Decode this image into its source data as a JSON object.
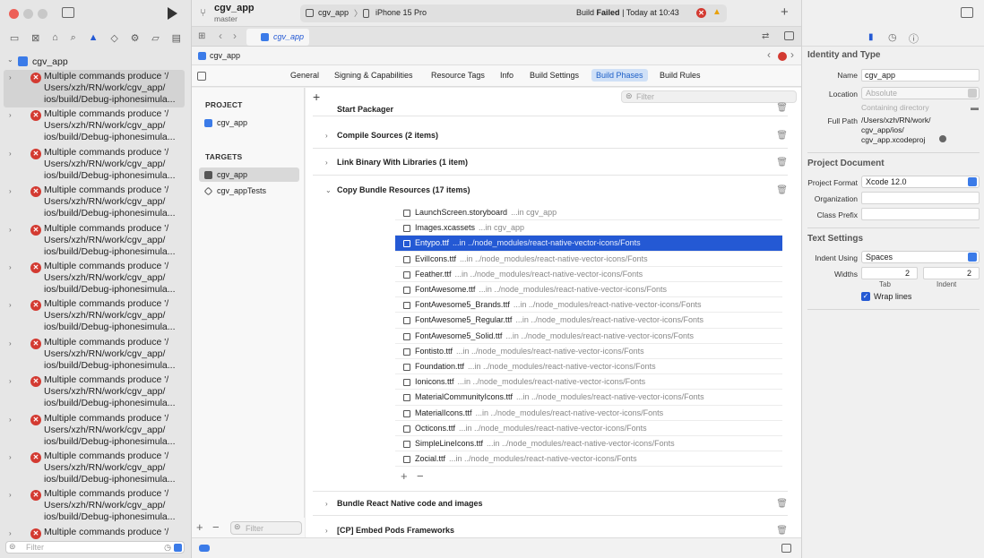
{
  "window": {
    "project": "cgv_app",
    "branch": "master"
  },
  "toolbar": {
    "scheme": "cgv_app",
    "device": "iPhone 15 Pro",
    "build_status_prefix": "Build",
    "build_status": "Failed",
    "build_time": "| Today at 10:43"
  },
  "navigator": {
    "root": "cgv_app",
    "filter_placeholder": "Filter",
    "issues": [
      {
        "line1": "Multiple commands produce '/",
        "line2": "Users/xzh/RN/work/cgv_app/",
        "line3": "ios/build/Debug-iphonesimula..."
      },
      {
        "line1": "Multiple commands produce '/",
        "line2": "Users/xzh/RN/work/cgv_app/",
        "line3": "ios/build/Debug-iphonesimula..."
      },
      {
        "line1": "Multiple commands produce '/",
        "line2": "Users/xzh/RN/work/cgv_app/",
        "line3": "ios/build/Debug-iphonesimula..."
      },
      {
        "line1": "Multiple commands produce '/",
        "line2": "Users/xzh/RN/work/cgv_app/",
        "line3": "ios/build/Debug-iphonesimula..."
      },
      {
        "line1": "Multiple commands produce '/",
        "line2": "Users/xzh/RN/work/cgv_app/",
        "line3": "ios/build/Debug-iphonesimula..."
      },
      {
        "line1": "Multiple commands produce '/",
        "line2": "Users/xzh/RN/work/cgv_app/",
        "line3": "ios/build/Debug-iphonesimula..."
      },
      {
        "line1": "Multiple commands produce '/",
        "line2": "Users/xzh/RN/work/cgv_app/",
        "line3": "ios/build/Debug-iphonesimula..."
      },
      {
        "line1": "Multiple commands produce '/",
        "line2": "Users/xzh/RN/work/cgv_app/",
        "line3": "ios/build/Debug-iphonesimula..."
      },
      {
        "line1": "Multiple commands produce '/",
        "line2": "Users/xzh/RN/work/cgv_app/",
        "line3": "ios/build/Debug-iphonesimula..."
      },
      {
        "line1": "Multiple commands produce '/",
        "line2": "Users/xzh/RN/work/cgv_app/",
        "line3": "ios/build/Debug-iphonesimula..."
      },
      {
        "line1": "Multiple commands produce '/",
        "line2": "Users/xzh/RN/work/cgv_app/",
        "line3": "ios/build/Debug-iphonesimula..."
      },
      {
        "line1": "Multiple commands produce '/",
        "line2": "Users/xzh/RN/work/cgv_app/",
        "line3": "ios/build/Debug-iphonesimula..."
      },
      {
        "line1": "Multiple commands produce '/",
        "line2": "",
        "line3": ""
      }
    ]
  },
  "editor": {
    "tab": "cgv_app",
    "jump": "cgv_app",
    "tabs": [
      "General",
      "Signing & Capabilities",
      "Resource Tags",
      "Info",
      "Build Settings",
      "Build Phases",
      "Build Rules"
    ],
    "active_tab": "Build Phases",
    "filter_placeholder": "Filter",
    "project_header": "PROJECT",
    "project_item": "cgv_app",
    "targets_header": "TARGETS",
    "targets": [
      "cgv_app",
      "cgv_appTests"
    ],
    "list_filter_placeholder": "Filter"
  },
  "phases": {
    "start_packager": "Start Packager",
    "compile_sources": "Compile Sources (2 items)",
    "link_binary": "Link Binary With Libraries (1 item)",
    "copy_bundle": "Copy Bundle Resources (17 items)",
    "bundle_rn": "Bundle React Native code and images",
    "embed_pods": "[CP] Embed Pods Frameworks",
    "files": [
      {
        "name": "LaunchScreen.storyboard",
        "path": "...in cgv_app"
      },
      {
        "name": "Images.xcassets",
        "path": "...in cgv_app"
      },
      {
        "name": "Entypo.ttf",
        "path": "...in ../node_modules/react-native-vector-icons/Fonts"
      },
      {
        "name": "EvilIcons.ttf",
        "path": "...in ../node_modules/react-native-vector-icons/Fonts"
      },
      {
        "name": "Feather.ttf",
        "path": "...in ../node_modules/react-native-vector-icons/Fonts"
      },
      {
        "name": "FontAwesome.ttf",
        "path": "...in ../node_modules/react-native-vector-icons/Fonts"
      },
      {
        "name": "FontAwesome5_Brands.ttf",
        "path": "...in ../node_modules/react-native-vector-icons/Fonts"
      },
      {
        "name": "FontAwesome5_Regular.ttf",
        "path": "...in ../node_modules/react-native-vector-icons/Fonts"
      },
      {
        "name": "FontAwesome5_Solid.ttf",
        "path": "...in ../node_modules/react-native-vector-icons/Fonts"
      },
      {
        "name": "Fontisto.ttf",
        "path": "...in ../node_modules/react-native-vector-icons/Fonts"
      },
      {
        "name": "Foundation.ttf",
        "path": "...in ../node_modules/react-native-vector-icons/Fonts"
      },
      {
        "name": "Ionicons.ttf",
        "path": "...in ../node_modules/react-native-vector-icons/Fonts"
      },
      {
        "name": "MaterialCommunityIcons.ttf",
        "path": "...in ../node_modules/react-native-vector-icons/Fonts"
      },
      {
        "name": "MaterialIcons.ttf",
        "path": "...in ../node_modules/react-native-vector-icons/Fonts"
      },
      {
        "name": "Octicons.ttf",
        "path": "...in ../node_modules/react-native-vector-icons/Fonts"
      },
      {
        "name": "SimpleLineIcons.ttf",
        "path": "...in ../node_modules/react-native-vector-icons/Fonts"
      },
      {
        "name": "Zocial.ttf",
        "path": "...in ../node_modules/react-native-vector-icons/Fonts"
      }
    ],
    "selected_index": 2
  },
  "inspector": {
    "identity_header": "Identity and Type",
    "name_label": "Name",
    "name_value": "cgv_app",
    "location_label": "Location",
    "location_value": "Absolute",
    "containing": "Containing directory",
    "fullpath_label": "Full Path",
    "fullpath_1": "/Users/xzh/RN/work/",
    "fullpath_2": "cgv_app/ios/",
    "fullpath_3": "cgv_app.xcodeproj",
    "projdoc_header": "Project Document",
    "format_label": "Project Format",
    "format_value": "Xcode 12.0",
    "org_label": "Organization",
    "prefix_label": "Class Prefix",
    "text_header": "Text Settings",
    "indent_label": "Indent Using",
    "indent_value": "Spaces",
    "widths_label": "Widths",
    "tab_value": "2",
    "indent_width_value": "2",
    "tab_caption": "Tab",
    "indent_caption": "Indent",
    "wrap_label": "Wrap lines"
  },
  "colors": {
    "accent": "#2459d4",
    "error": "#d33a31",
    "warning": "#e8a10a"
  }
}
